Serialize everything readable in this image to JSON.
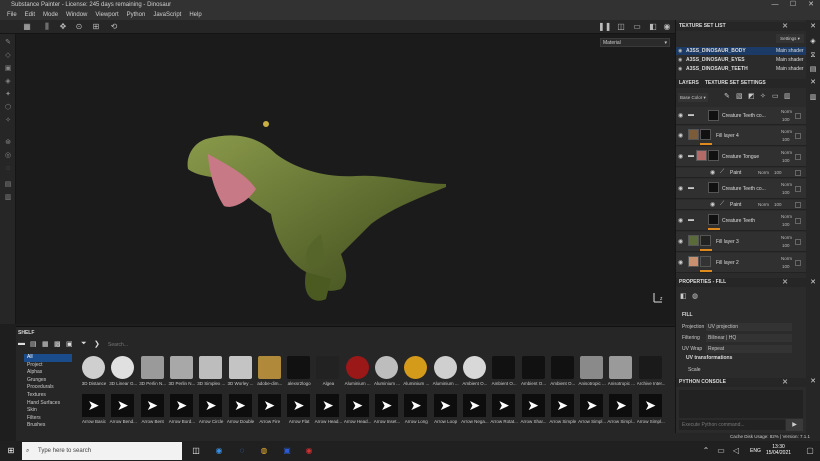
{
  "window": {
    "title": "Substance Painter - License: 245 days remaining - Dinosaur",
    "controls": [
      "—",
      "☐",
      "✕"
    ]
  },
  "menu": [
    "File",
    "Edit",
    "Mode",
    "Window",
    "Viewport",
    "Python",
    "JavaScript",
    "Help"
  ],
  "viewport": {
    "channel": "Material"
  },
  "texture_set_list": {
    "title": "TEXTURE SET LIST",
    "settings": "Settings ▾",
    "items": [
      {
        "name": "A3SS_DINOSAUR_BODY",
        "shader": "Main shader"
      },
      {
        "name": "A3SS_DINOSAUR_EYES",
        "shader": "Main shader"
      },
      {
        "name": "A3SS_DINOSAUR_TEETH",
        "shader": "Main shader"
      }
    ]
  },
  "layers": {
    "tab1": "LAYERS",
    "tab2": "TEXTURE SET SETTINGS",
    "channel": "Base Color",
    "rows": [
      {
        "name": "Creature Teeth co...",
        "blend": "Norm",
        "opacity": "100"
      },
      {
        "name": "Fill layer 4",
        "blend": "Norm",
        "opacity": "100"
      },
      {
        "name": "Creature Tongue",
        "blend": "Norm",
        "opacity": "100"
      },
      {
        "name": "Paint",
        "blend": "Norm",
        "opacity": "100"
      },
      {
        "name": "Creature Teeth co...",
        "blend": "Norm",
        "opacity": "100"
      },
      {
        "name": "Paint",
        "blend": "Norm",
        "opacity": "100"
      },
      {
        "name": "Creature Teeth",
        "blend": "Norm",
        "opacity": "100"
      },
      {
        "name": "Fill layer 3",
        "blend": "Norm",
        "opacity": "100"
      },
      {
        "name": "Fill layer 2",
        "blend": "Norm",
        "opacity": "100"
      }
    ]
  },
  "properties": {
    "title": "PROPERTIES - FILL",
    "section": "FILL",
    "projection_label": "Projection",
    "projection": "UV projection",
    "filtering_label": "Filtering",
    "filtering": "Bilinear | HQ",
    "uvwrap_label": "UV Wrap",
    "uvwrap": "Repeat",
    "uvt": "UV transformations",
    "scale": "Scale"
  },
  "python": {
    "title": "PYTHON CONSOLE",
    "placeholder": "Execute Python command..."
  },
  "status": {
    "text": "Cache Disk Usage:  82% | Version: 7.1.1"
  },
  "shelf": {
    "title": "SHELF",
    "search": "Search...",
    "categories": [
      "All",
      "Project",
      "Alphas",
      "Grunges",
      "Procedurals",
      "Textures",
      "Hand Surfaces",
      "Skin",
      "Filters",
      "Brushes"
    ],
    "row1": [
      "3D Distance",
      "3D Linear G...",
      "3D Perlin N...",
      "3D Perlin N...",
      "3D Simplex ...",
      "3D Worley ...",
      "adobe-dim...",
      "alexsr2logo",
      "Algea",
      "Aluminium ...",
      "Aluminium ...",
      "Aluminium ...",
      "Aluminium ...",
      "Ambient O...",
      "Ambient O...",
      "Ambient O...",
      "Ambient O...",
      "Anisotropic ...",
      "Anisotropic ...",
      "Archive Inter..."
    ],
    "row2": [
      "Arrow Basic",
      "Arrow Bend...",
      "Arrow Bent",
      "Arrow Bord...",
      "Arrow Circle",
      "Arrow Double",
      "Arrow Fire",
      "Arrow Flat",
      "Arrow Head...",
      "Arrow Head...",
      "Arrow Inset...",
      "Arrow Long",
      "Arrow Loop",
      "Arrow Nega...",
      "Arrow Rotat...",
      "Arrow Shar...",
      "Arrow Simple",
      "Arrow Simpl...",
      "Arrow Simpl...",
      "Arrow Simpl..."
    ]
  },
  "taskbar": {
    "search": "Type here to search",
    "lang": "ENG",
    "time": "13:30",
    "date": "15/04/2021"
  }
}
